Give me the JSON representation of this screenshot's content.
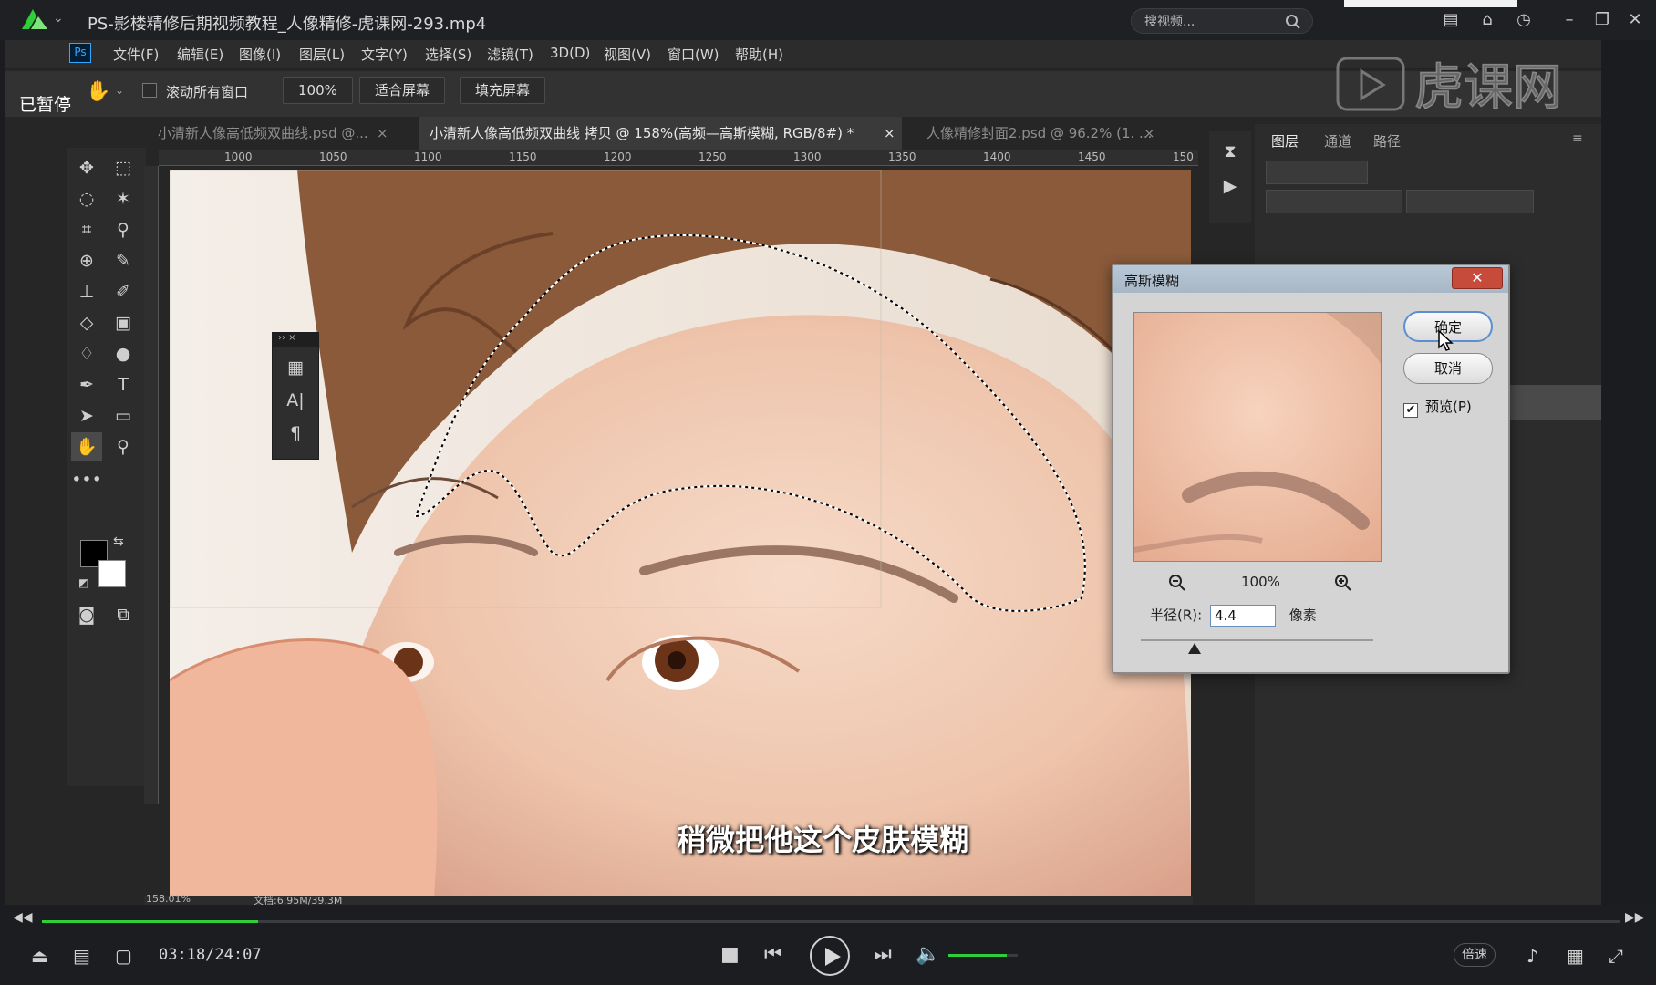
{
  "player": {
    "title": "PS-影楼精修后期视频教程_人像精修-虎课网-293.mp4",
    "search_placeholder": "搜视频...",
    "time": "03:18/24:07",
    "speed_label": "倍速",
    "progress": 0.137,
    "volume": 0.84,
    "paused_label": "已暂停",
    "watermark": "虎课网"
  },
  "photoshop": {
    "logo": "Ps",
    "menu": [
      "文件(F)",
      "编辑(E)",
      "图像(I)",
      "图层(L)",
      "文字(Y)",
      "选择(S)",
      "滤镜(T)",
      "3D(D)",
      "视图(V)",
      "窗口(W)",
      "帮助(H)"
    ],
    "options": {
      "scroll_all_label": "滚动所有窗口",
      "zoom_label": "100%",
      "fit_screen_label": "适合屏幕",
      "fill_screen_label": "填充屏幕"
    },
    "tabs": [
      {
        "label": "小清新人像高低频双曲线.psd @...",
        "active": false
      },
      {
        "label": "小清新人像高低频双曲线 拷贝 @ 158%(高频—高斯模糊, RGB/8#) *",
        "active": true
      },
      {
        "label": "人像精修封面2.psd @ 96.2% (1. ...",
        "active": false
      }
    ],
    "ruler_labels": [
      "1000",
      "1050",
      "1100",
      "1150",
      "1200",
      "1250",
      "1300",
      "1350",
      "1400",
      "1450",
      "150"
    ],
    "panel_tabs": [
      "图层",
      "通道",
      "路径"
    ],
    "status_zoom": "158.01%",
    "status_doc": "文档:6.95M/39.3M"
  },
  "dialog": {
    "title": "高斯模糊",
    "ok_label": "确定",
    "cancel_label": "取消",
    "preview_label": "预览(P)",
    "preview_checked": true,
    "zoom_label": "100%",
    "radius_label": "半径(R):",
    "radius_value": "4.4",
    "unit_label": "像素"
  },
  "subtitle": "稍微把他这个皮肤模糊",
  "colors": {
    "accent_green": "#2fcf3a",
    "ps_blue": "#31a8ff",
    "dialog_close_red": "#c74b3b"
  }
}
